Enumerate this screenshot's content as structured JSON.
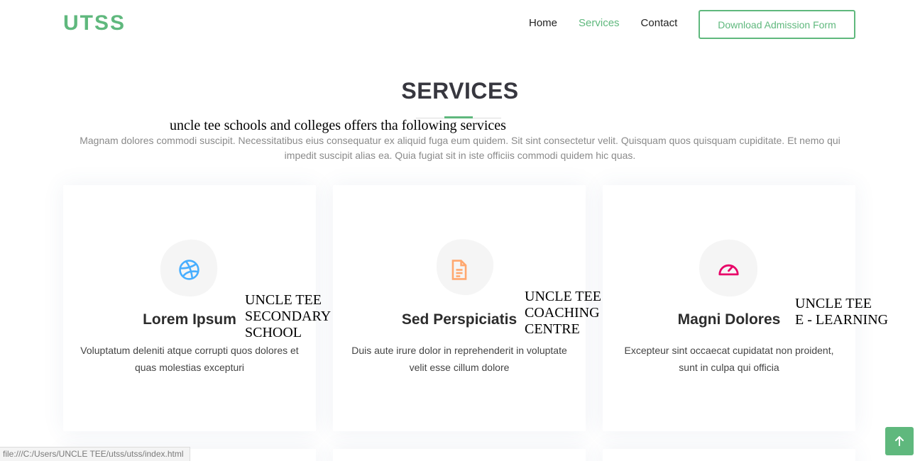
{
  "header": {
    "logo": "UTSS",
    "nav": [
      {
        "label": "Home"
      },
      {
        "label": "Services"
      },
      {
        "label": "Contact"
      }
    ],
    "download_button": "Download Admission Form"
  },
  "section": {
    "title": "SERVICES",
    "overlay_subtitle": "uncle tee schools and colleges offers tha following services",
    "description": "Magnam dolores commodi suscipit. Necessitatibus eius consequatur ex aliquid fuga eum quidem. Sit sint consectetur velit. Quisquam quos quisquam cupiditate. Et nemo qui impedit suscipit alias ea. Quia fugiat sit in iste officiis commodi quidem hic quas."
  },
  "cards": [
    {
      "title": "Lorem Ipsum",
      "text": "Voluptatum deleniti atque corrupti quos dolores et quas molestias excepturi",
      "overlay": "UNCLE TEE\nSECONDARY\nSCHOOL",
      "icon": "dribbble-icon",
      "icon_color": "#47aeff"
    },
    {
      "title": "Sed Perspiciatis",
      "text": "Duis aute irure dolor in reprehenderit in voluptate velit esse cillum dolore",
      "overlay": "UNCLE TEE\nCOACHING\nCENTRE",
      "icon": "file-text-icon",
      "icon_color": "#ffa76e"
    },
    {
      "title": "Magni Dolores",
      "text": "Excepteur sint occaecat cupidatat non proident, sunt in culpa qui officia",
      "overlay": "UNCLE TEE\nE - LEARNING",
      "icon": "speedometer-icon",
      "icon_color": "#e80368"
    }
  ],
  "status_bar": "file:///C:/Users/UNCLE TEE/utss/utss/index.html",
  "colors": {
    "accent": "#5fb87d",
    "heading": "#37373f",
    "muted": "#8a8a8a"
  }
}
